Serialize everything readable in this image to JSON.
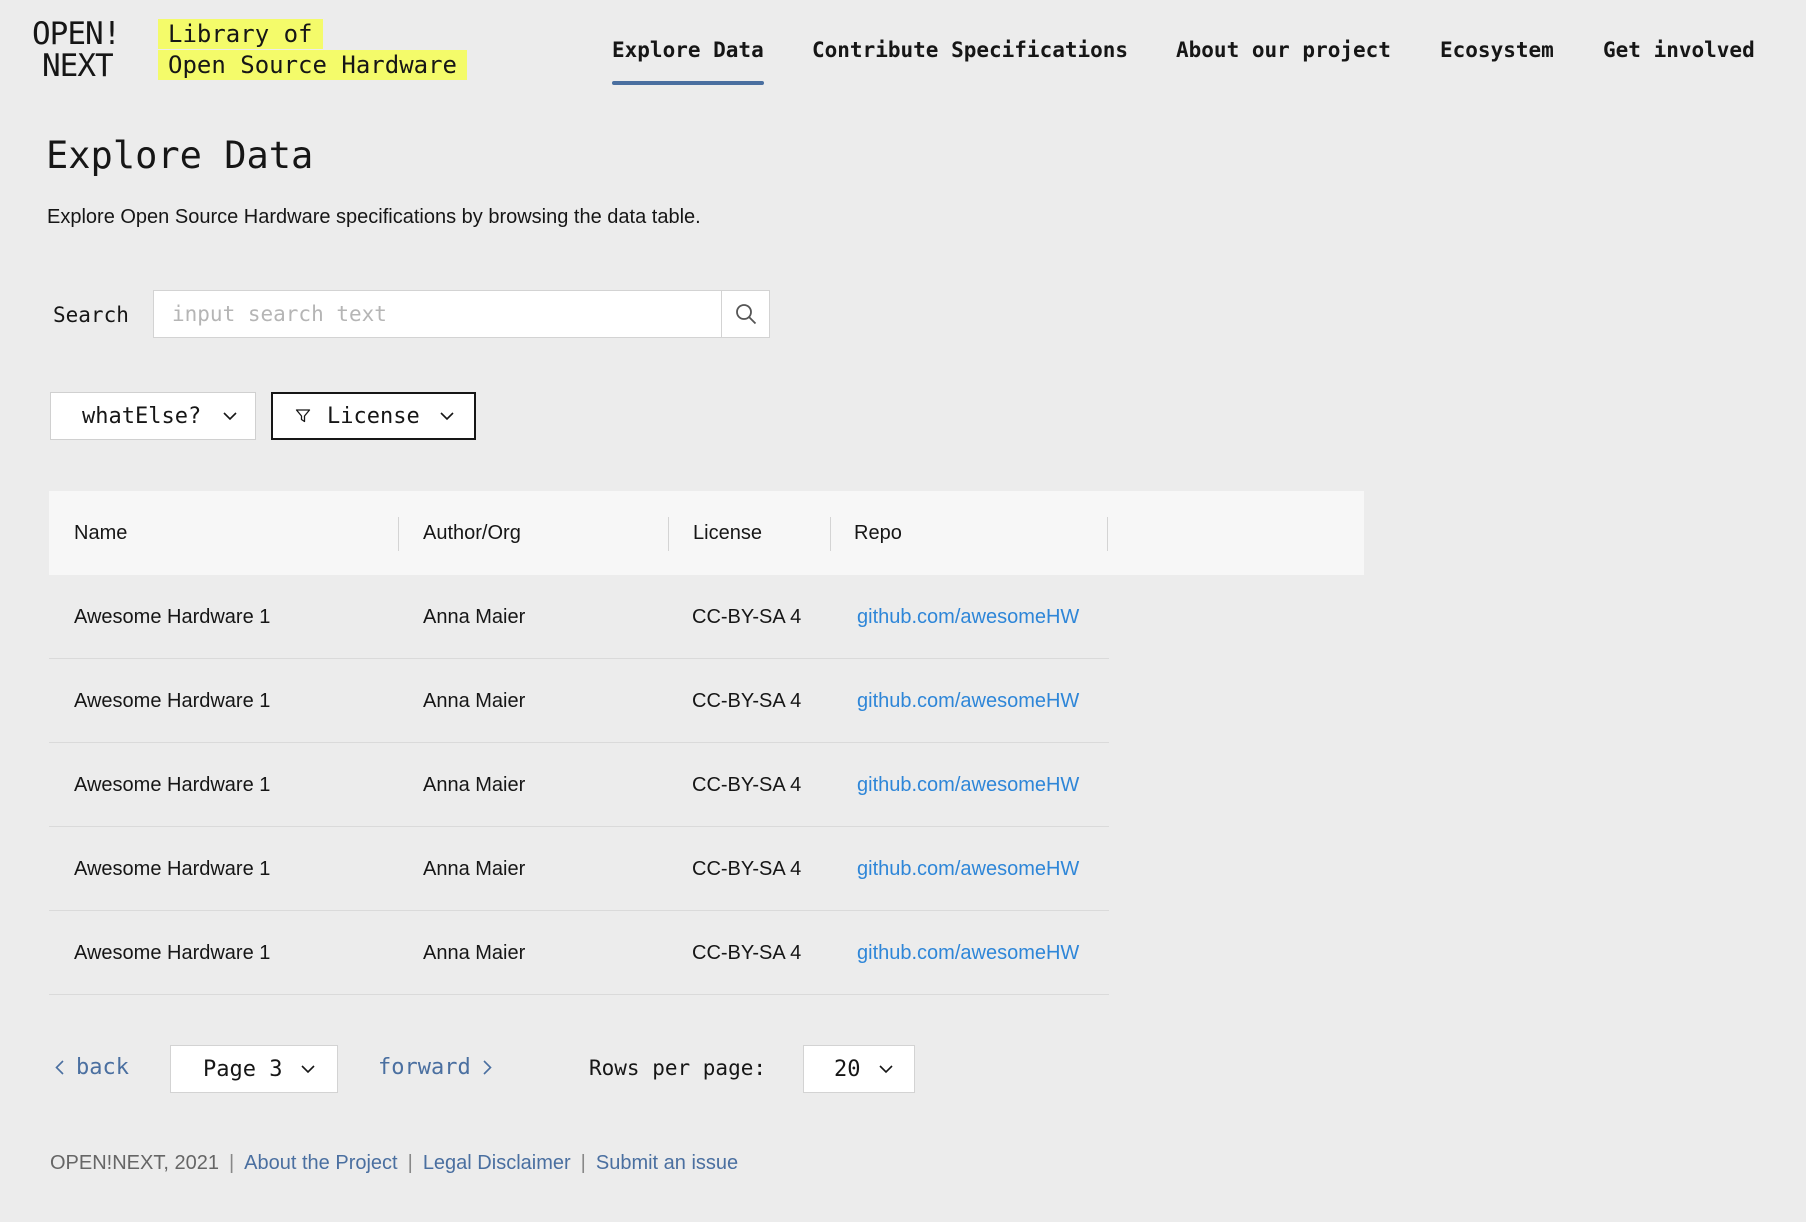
{
  "header": {
    "logo_line1": "OPEN!",
    "logo_line2": "NEXT",
    "tagline_line1": "Library of",
    "tagline_line2": "Open Source Hardware",
    "nav": {
      "explore": "Explore Data",
      "contribute": "Contribute Specifications",
      "about": "About our project",
      "ecosystem": "Ecosystem",
      "get_involved": "Get involved"
    },
    "active_nav": "Explore Data"
  },
  "main": {
    "title": "Explore Data",
    "description": "Explore Open Source Hardware specifications by browsing the data table."
  },
  "search": {
    "label": "Search",
    "placeholder": "input search text",
    "value": ""
  },
  "filters": {
    "whatelse": "whatElse?",
    "license": "License"
  },
  "table": {
    "columns": [
      "Name",
      "Author/Org",
      "License",
      "Repo"
    ],
    "rows": [
      [
        "Awesome Hardware 1",
        "Anna Maier",
        "CC-BY-SA 4",
        "github.com/awesomeHW"
      ],
      [
        "Awesome Hardware 1",
        "Anna Maier",
        "CC-BY-SA 4",
        "github.com/awesomeHW"
      ],
      [
        "Awesome Hardware 1",
        "Anna Maier",
        "CC-BY-SA 4",
        "github.com/awesomeHW"
      ],
      [
        "Awesome Hardware 1",
        "Anna Maier",
        "CC-BY-SA 4",
        "github.com/awesomeHW"
      ],
      [
        "Awesome Hardware 1",
        "Anna Maier",
        "CC-BY-SA 4",
        "github.com/awesomeHW"
      ]
    ]
  },
  "pagination": {
    "back": "back",
    "page": "Page 3",
    "forward": "forward",
    "rows_per_page_label": "Rows per page:",
    "rows_per_page": "20"
  },
  "footer": {
    "copyright": "OPEN!NEXT, 2021",
    "links": [
      "About the Project",
      "Legal Disclaimer",
      "Submit an issue"
    ]
  },
  "colors": {
    "background": "#ececec",
    "highlight": "#f4fb6a",
    "accent": "#4a6fa0",
    "link": "#2e86d8"
  }
}
